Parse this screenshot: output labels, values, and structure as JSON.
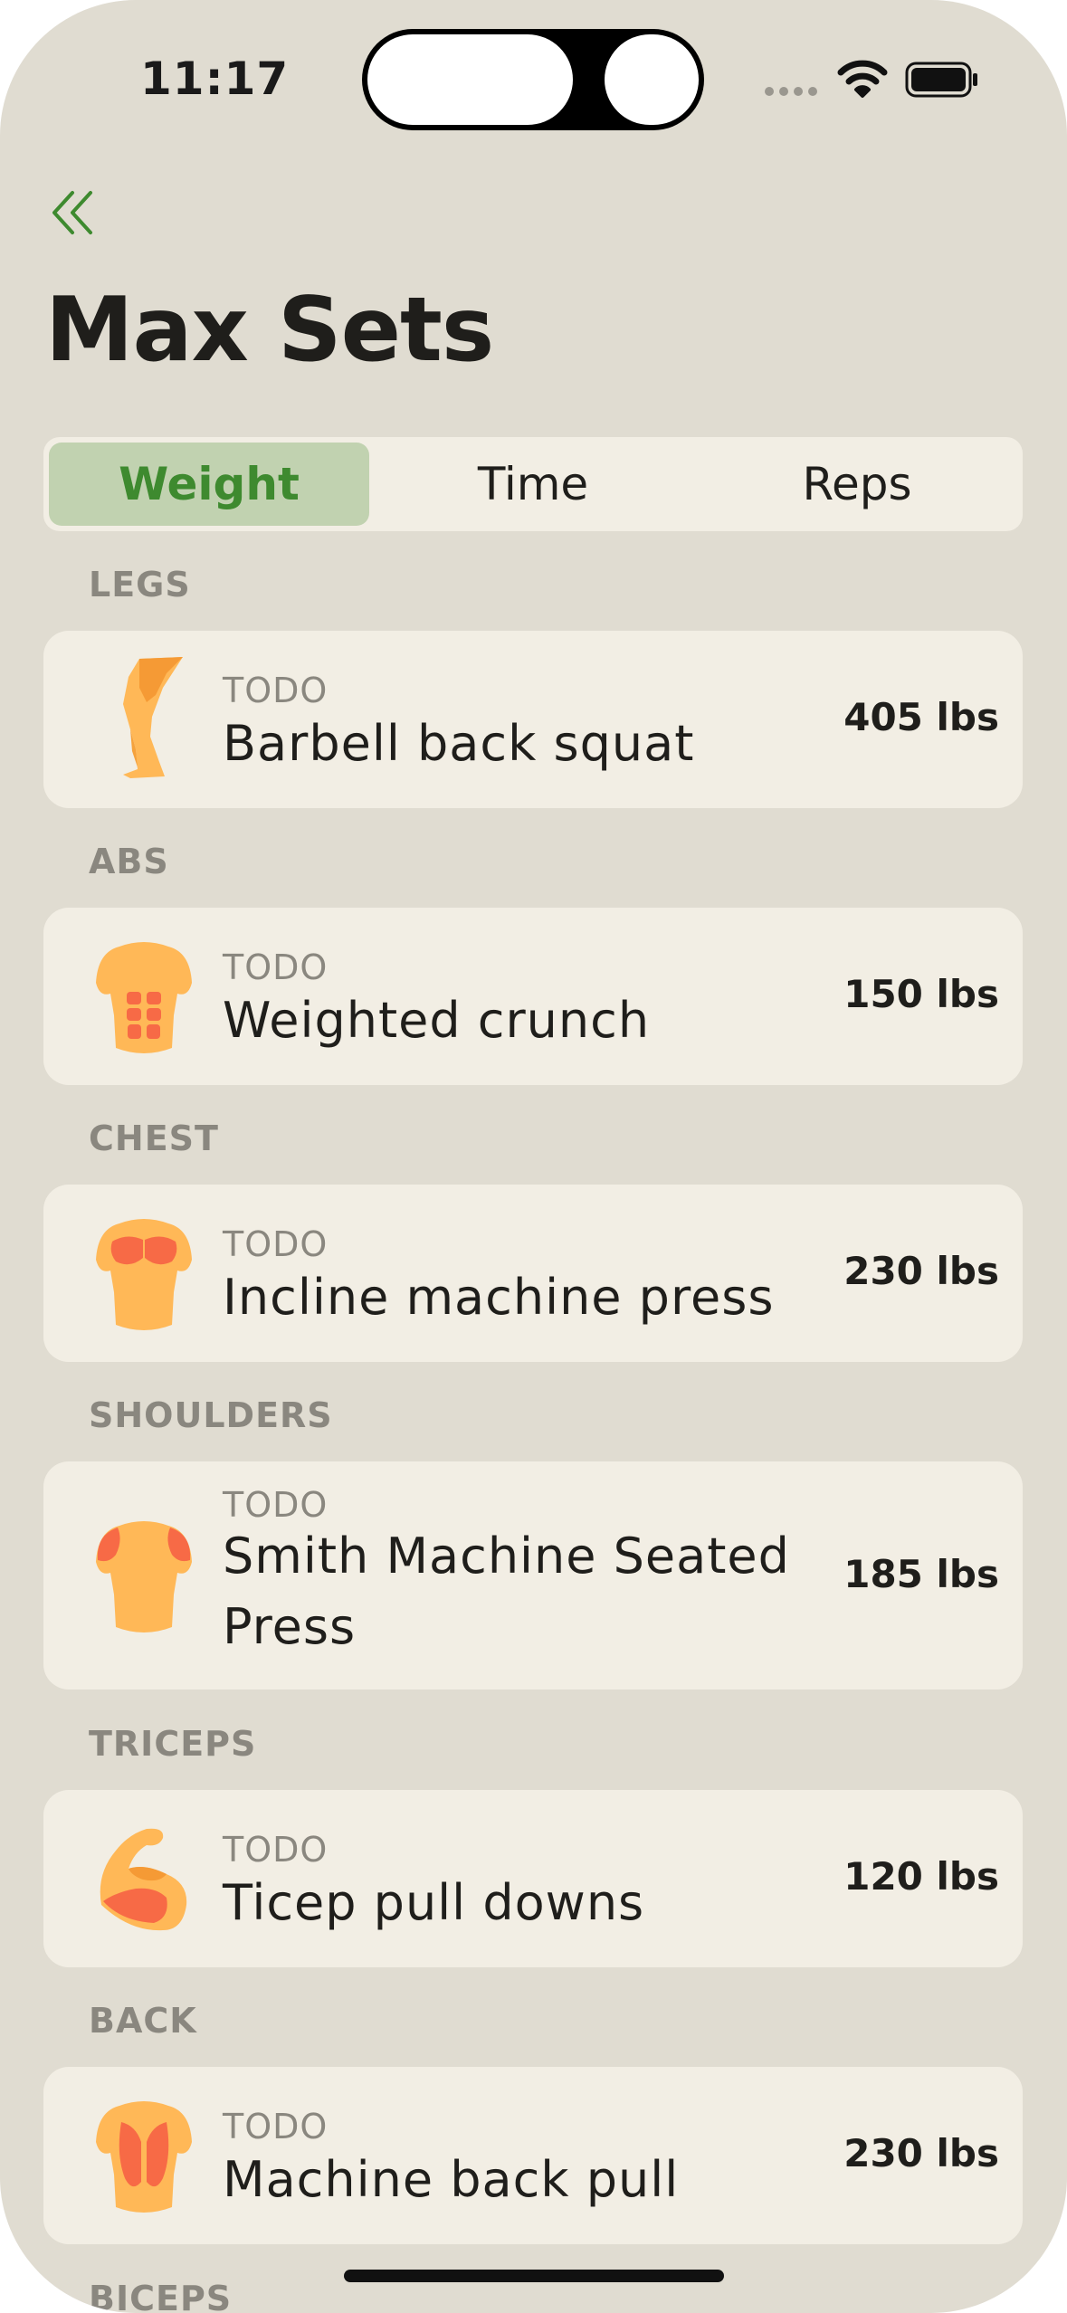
{
  "status_bar": {
    "time": "11:17"
  },
  "header": {
    "title": "Max Sets"
  },
  "segments": [
    {
      "label": "Weight",
      "active": true
    },
    {
      "label": "Time",
      "active": false
    },
    {
      "label": "Reps",
      "active": false
    }
  ],
  "sections": [
    {
      "label": "LEGS",
      "exercise": {
        "subtitle": "TODO",
        "name": "Barbell back squat",
        "value": "405 lbs",
        "icon": "leg-icon"
      }
    },
    {
      "label": "ABS",
      "exercise": {
        "subtitle": "TODO",
        "name": "Weighted crunch",
        "value": "150 lbs",
        "icon": "abs-torso-icon"
      }
    },
    {
      "label": "CHEST",
      "exercise": {
        "subtitle": "TODO",
        "name": "Incline machine press",
        "value": "230 lbs",
        "icon": "chest-torso-icon"
      }
    },
    {
      "label": "SHOULDERS",
      "exercise": {
        "subtitle": "TODO",
        "name": "Smith Machine Seated Press",
        "value": "185 lbs",
        "icon": "shoulders-torso-icon"
      }
    },
    {
      "label": "TRICEPS",
      "exercise": {
        "subtitle": "TODO",
        "name": "Ticep pull downs",
        "value": "120 lbs",
        "icon": "flexed-arm-icon"
      }
    },
    {
      "label": "BACK",
      "exercise": {
        "subtitle": "TODO",
        "name": "Machine back pull",
        "value": "230 lbs",
        "icon": "back-torso-icon"
      }
    },
    {
      "label": "BICEPS"
    }
  ],
  "colors": {
    "background": "#e0dcd1",
    "card": "#f2eee4",
    "accent": "#3e8a2f",
    "segment_active": "#c1d2b0",
    "muscle_base": "#ffb857",
    "muscle_highlight": "#f76a46"
  }
}
